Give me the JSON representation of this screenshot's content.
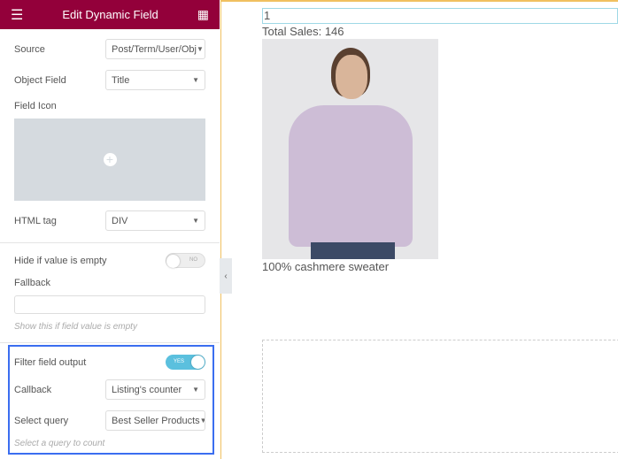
{
  "panel": {
    "title": "Edit Dynamic Field",
    "source_label": "Source",
    "source_value": "Post/Term/User/Obj",
    "object_field_label": "Object Field",
    "object_field_value": "Title",
    "field_icon_label": "Field Icon",
    "html_tag_label": "HTML tag",
    "html_tag_value": "DIV",
    "hide_empty_label": "Hide if value is empty",
    "hide_empty_toggle": "NO",
    "fallback_label": "Fallback",
    "fallback_value": "",
    "fallback_hint": "Show this if field value is empty",
    "filter_label": "Filter field output",
    "filter_toggle": "YES",
    "callback_label": "Callback",
    "callback_value": "Listing's counter",
    "query_label": "Select query",
    "query_value": "Best Seller Products",
    "query_hint": "Select a query to count"
  },
  "canvas": {
    "counter": "1",
    "total_sales": "Total Sales: 146",
    "product_title": "100% cashmere sweater"
  },
  "colors": {
    "header": "#93003a",
    "highlight": "#3b6ef0",
    "toggle_on": "#5bc0de"
  }
}
